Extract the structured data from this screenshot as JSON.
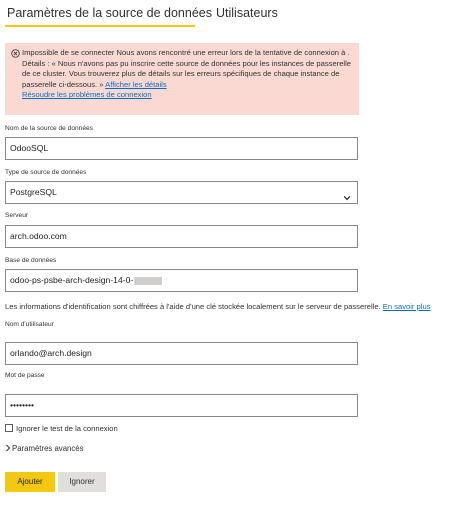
{
  "tabs": {
    "datasource_settings": "Paramètres de la source de données",
    "users": "Utilisateurs"
  },
  "error": {
    "message": "Impossible de se connecter Nous avons rencontré une erreur lors de la tentative de connexion à . Détails : « Nous n'avons pas pu inscrire cette source de données pour les instances de passerelle de ce cluster. Vous trouverez plus de détails sur les erreurs spécifiques de chaque instance de passerelle ci-dessous. » ",
    "details_link": "Afficher les détails",
    "troubleshoot_link": "Résoudre les problèmes de connexion"
  },
  "form": {
    "datasource_name_label": "Nom de la source de données",
    "datasource_name_value": "OdooSQL",
    "datasource_type_label": "Type de source de données",
    "datasource_type_value": "PostgreSQL",
    "server_label": "Serveur",
    "server_value": "arch.odoo.com",
    "database_label": "Base de données",
    "database_value": "odoo-ps-psbe-arch-design-14-0-",
    "credentials_info": "Les informations d'identification sont chiffrées à l'aide d'une clé stockée localement sur le serveur de passerelle. ",
    "learn_more_link": "En savoir plus",
    "username_label": "Nom d'utilisateur",
    "username_value": "orlando@arch.design",
    "password_label": "Mot de passe",
    "password_value": "••••••••",
    "skip_test_label": "Ignorer le test de la connexion",
    "advanced_label": "Paramètres avancés"
  },
  "buttons": {
    "add": "Ajouter",
    "ignore": "Ignorer"
  },
  "colors": {
    "accent": "#f2c811",
    "error_bg": "#fbd9d3",
    "link": "#0a6ebd"
  },
  "icons": {
    "error": "error-circle-icon",
    "select": "chevron-down-icon",
    "advanced": "chevron-right-icon"
  }
}
